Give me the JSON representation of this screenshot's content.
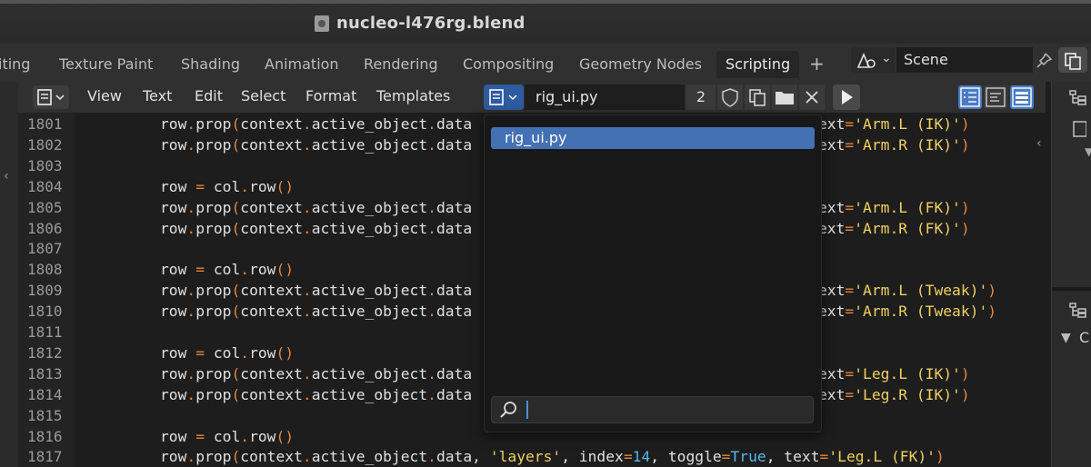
{
  "window": {
    "title": "nucleo-l476rg.blend",
    "file_icon": "blend-file-icon"
  },
  "workspace_tabs": [
    {
      "label": "iting",
      "active": false
    },
    {
      "label": "Texture Paint",
      "active": false
    },
    {
      "label": "Shading",
      "active": false
    },
    {
      "label": "Animation",
      "active": false
    },
    {
      "label": "Rendering",
      "active": false
    },
    {
      "label": "Compositing",
      "active": false
    },
    {
      "label": "Geometry Nodes",
      "active": false
    },
    {
      "label": "Scripting",
      "active": true
    }
  ],
  "add_tab_label": "+",
  "scene": {
    "name": "Scene"
  },
  "editor_header": {
    "menus": [
      "View",
      "Text",
      "Edit",
      "Select",
      "Format",
      "Templates"
    ],
    "text_block_name": "rig_ui.py",
    "users_count": "2"
  },
  "dropdown": {
    "items": [
      "rig_ui.py"
    ],
    "search_value": ""
  },
  "code": {
    "lines": [
      {
        "n": "1801",
        "code": "row.prop(context.active_object.data",
        "tail": "ext='Arm.L (IK)')"
      },
      {
        "n": "1802",
        "code": "row.prop(context.active_object.data",
        "tail": "ext='Arm.R (IK)')"
      },
      {
        "n": "1803",
        "code": "",
        "tail": ""
      },
      {
        "n": "1804",
        "code": "row = col.row()",
        "tail": ""
      },
      {
        "n": "1805",
        "code": "row.prop(context.active_object.data",
        "tail": "ext='Arm.L (FK)')"
      },
      {
        "n": "1806",
        "code": "row.prop(context.active_object.data",
        "tail": "ext='Arm.R (FK)')"
      },
      {
        "n": "1807",
        "code": "",
        "tail": ""
      },
      {
        "n": "1808",
        "code": "row = col.row()",
        "tail": ""
      },
      {
        "n": "1809",
        "code": "row.prop(context.active_object.data",
        "tail": "ext='Arm.L (Tweak)')"
      },
      {
        "n": "1810",
        "code": "row.prop(context.active_object.data",
        "tail": "ext='Arm.R (Tweak)')"
      },
      {
        "n": "1811",
        "code": "",
        "tail": ""
      },
      {
        "n": "1812",
        "code": "row = col.row()",
        "tail": ""
      },
      {
        "n": "1813",
        "code": "row.prop(context.active_object.data",
        "tail": "ext='Leg.L (IK)')"
      },
      {
        "n": "1814",
        "code": "row.prop(context.active_object.data",
        "tail": "ext='Leg.R (IK)')"
      },
      {
        "n": "1815",
        "code": "",
        "tail": ""
      },
      {
        "n": "1816",
        "code": "row = col.row()",
        "tail": ""
      },
      {
        "n": "1817",
        "code": "row.prop(context.active_object.data, 'layers', index=14, toggle=True, text='Leg.L (FK)')",
        "tail": ""
      }
    ]
  },
  "colors": {
    "keyword_operator": "#e6863a",
    "string": "#f0d060",
    "number": "#54b8e8",
    "selection": "#4471b3"
  },
  "right_panel": {
    "tree_label": "C"
  }
}
